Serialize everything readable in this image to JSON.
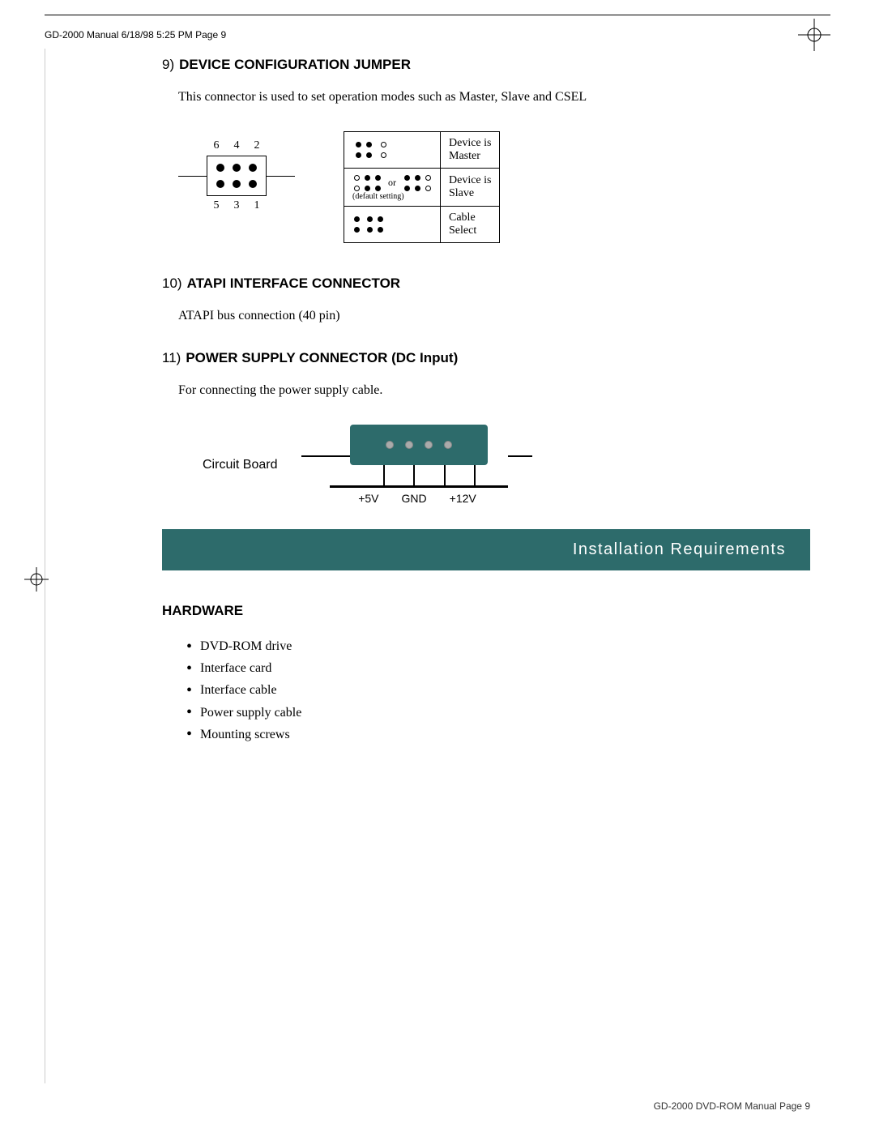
{
  "header": {
    "text": "GD-2000 Manual  6/18/98  5:25 PM   Page 9"
  },
  "section9": {
    "number": "9)",
    "title": "DEVICE CONFIGURATION JUMPER",
    "body": "This connector is used to set operation modes such as Master, Slave and CSEL",
    "pin_numbers_top": [
      "6",
      "4",
      "2"
    ],
    "pin_numbers_bottom": [
      "5",
      "3",
      "1"
    ],
    "jumper_modes": [
      {
        "label": "Device is\nMaster"
      },
      {
        "label": "Device is\nSlave",
        "has_or": true,
        "default": "(default setting)"
      },
      {
        "label": "Cable\nSelect"
      }
    ]
  },
  "section10": {
    "number": "10)",
    "title": "ATAPI INTERFACE CONNECTOR",
    "body": "ATAPI bus connection (40 pin)"
  },
  "section11": {
    "number": "11)",
    "title": "POWER SUPPLY CONNECTOR (DC Input)",
    "body": "For connecting the power supply cable."
  },
  "circuit_board": {
    "label": "Circuit Board",
    "voltage_labels": [
      "+5V",
      "GND",
      "+12V"
    ]
  },
  "installation_banner": {
    "text": "Installation Requirements"
  },
  "hardware": {
    "title": "HARDWARE",
    "items": [
      "DVD-ROM drive",
      "Interface card",
      "Interface cable",
      "Power supply cable",
      "Mounting screws"
    ]
  },
  "footer": {
    "text": "GD-2000 DVD-ROM Manual  Page 9"
  }
}
